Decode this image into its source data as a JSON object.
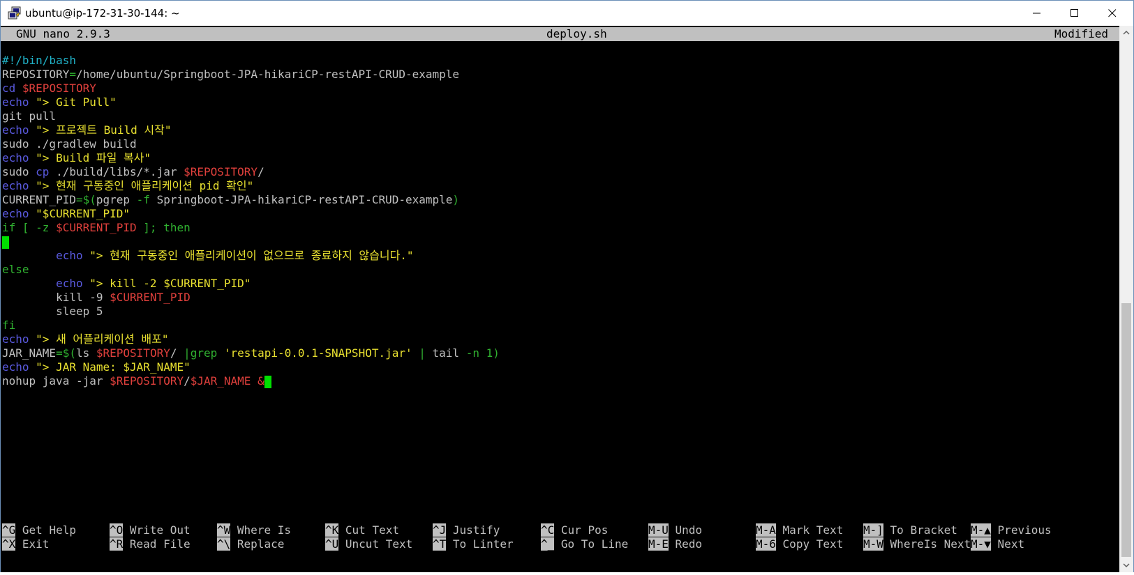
{
  "window": {
    "title": "ubuntu@ip-172-31-30-144: ~",
    "minimize_glyph": "minimize-icon",
    "maximize_glyph": "maximize-icon",
    "close_glyph": "close-icon"
  },
  "header": {
    "version": "GNU nano 2.9.3",
    "filename": "deploy.sh",
    "status": "Modified"
  },
  "lines": [
    [
      {
        "t": "#!/bin/bash",
        "c": "comment"
      }
    ],
    [
      {
        "t": "REPOSITORY",
        "c": "plain"
      },
      {
        "t": "=",
        "c": "green"
      },
      {
        "t": "/home/ubuntu/Springboot-JPA-hikariCP-restAPI-CRUD-example",
        "c": "plain"
      }
    ],
    [
      {
        "t": "cd ",
        "c": "kw"
      },
      {
        "t": "$REPOSITORY",
        "c": "var"
      }
    ],
    [
      {
        "t": "echo ",
        "c": "kw"
      },
      {
        "t": "\"> Git Pull\"",
        "c": "str"
      }
    ],
    [
      {
        "t": "git pull",
        "c": "plain"
      }
    ],
    [
      {
        "t": "echo ",
        "c": "kw"
      },
      {
        "t": "\"> 프로젝트 Build 시작\"",
        "c": "str"
      }
    ],
    [
      {
        "t": "sudo ./gradlew build",
        "c": "plain"
      }
    ],
    [
      {
        "t": "echo ",
        "c": "kw"
      },
      {
        "t": "\"> Build 파일 복사\"",
        "c": "str"
      }
    ],
    [
      {
        "t": "sudo ",
        "c": "plain"
      },
      {
        "t": "cp",
        "c": "kw"
      },
      {
        "t": " ./build/libs/*.jar ",
        "c": "plain"
      },
      {
        "t": "$REPOSITORY",
        "c": "var"
      },
      {
        "t": "/",
        "c": "plain"
      }
    ],
    [
      {
        "t": "echo ",
        "c": "kw"
      },
      {
        "t": "\"> 현재 구동중인 애플리케이션 pid 확인\"",
        "c": "str"
      }
    ],
    [
      {
        "t": "CURRENT_PID",
        "c": "plain"
      },
      {
        "t": "=$(",
        "c": "green"
      },
      {
        "t": "pgrep ",
        "c": "plain"
      },
      {
        "t": "-f",
        "c": "green"
      },
      {
        "t": " Springboot-JPA-hikariCP-restAPI-CRUD-example",
        "c": "plain"
      },
      {
        "t": ")",
        "c": "green"
      }
    ],
    [
      {
        "t": "echo ",
        "c": "kw"
      },
      {
        "t": "\"$CURRENT_PID\"",
        "c": "str"
      }
    ],
    [
      {
        "t": "if [ -z ",
        "c": "green"
      },
      {
        "t": "$CURRENT_PID",
        "c": "var"
      },
      {
        "t": " ]; then",
        "c": "green"
      }
    ],
    [
      {
        "t": "",
        "c": "cursor"
      }
    ],
    [
      {
        "t": "        ",
        "c": "plain"
      },
      {
        "t": "echo ",
        "c": "kw"
      },
      {
        "t": "\"> 현재 구동중인 애플리케이션이 없으므로 종료하지 않습니다.\"",
        "c": "str"
      }
    ],
    [
      {
        "t": "else",
        "c": "green"
      }
    ],
    [
      {
        "t": "        ",
        "c": "plain"
      },
      {
        "t": "echo ",
        "c": "kw"
      },
      {
        "t": "\"> kill -2 $CURRENT_PID\"",
        "c": "str"
      }
    ],
    [
      {
        "t": "        kill -9 ",
        "c": "plain"
      },
      {
        "t": "$CURRENT_PID",
        "c": "var"
      }
    ],
    [
      {
        "t": "        sleep 5",
        "c": "plain"
      }
    ],
    [
      {
        "t": "fi",
        "c": "green"
      }
    ],
    [
      {
        "t": "echo ",
        "c": "kw"
      },
      {
        "t": "\"> 새 어플리케이션 배포\"",
        "c": "str"
      }
    ],
    [
      {
        "t": "JAR_NAME",
        "c": "plain"
      },
      {
        "t": "=$(",
        "c": "green"
      },
      {
        "t": "ls ",
        "c": "plain"
      },
      {
        "t": "$REPOSITORY",
        "c": "var"
      },
      {
        "t": "/ ",
        "c": "plain"
      },
      {
        "t": "|grep ",
        "c": "green"
      },
      {
        "t": "'restapi-0.0.1-SNAPSHOT.jar'",
        "c": "str"
      },
      {
        "t": " | ",
        "c": "green"
      },
      {
        "t": "tail ",
        "c": "plain"
      },
      {
        "t": "-n 1)",
        "c": "green"
      }
    ],
    [
      {
        "t": "echo ",
        "c": "kw"
      },
      {
        "t": "\"> JAR Name: $JAR_NAME\"",
        "c": "str"
      }
    ],
    [
      {
        "t": "nohup java -jar ",
        "c": "plain"
      },
      {
        "t": "$REPOSITORY",
        "c": "var"
      },
      {
        "t": "/",
        "c": "plain"
      },
      {
        "t": "$JAR_NAME",
        "c": "var"
      },
      {
        "t": " &",
        "c": "var"
      },
      {
        "t": "",
        "c": "cursor"
      }
    ]
  ],
  "shortcuts": {
    "row1": [
      {
        "key": "^G",
        "label": "Get Help"
      },
      {
        "key": "^O",
        "label": "Write Out"
      },
      {
        "key": "^W",
        "label": "Where Is"
      },
      {
        "key": "^K",
        "label": "Cut Text"
      },
      {
        "key": "^J",
        "label": "Justify"
      },
      {
        "key": "^C",
        "label": "Cur Pos"
      },
      {
        "key": "M-U",
        "label": "Undo"
      },
      {
        "key": "M-A",
        "label": "Mark Text"
      },
      {
        "key": "M-]",
        "label": "To Bracket"
      },
      {
        "key": "M-▲",
        "label": "Previous"
      }
    ],
    "row2": [
      {
        "key": "^X",
        "label": "Exit"
      },
      {
        "key": "^R",
        "label": "Read File"
      },
      {
        "key": "^\\",
        "label": "Replace"
      },
      {
        "key": "^U",
        "label": "Uncut Text"
      },
      {
        "key": "^T",
        "label": "To Linter"
      },
      {
        "key": "^_",
        "label": "Go To Line"
      },
      {
        "key": "M-E",
        "label": "Redo"
      },
      {
        "key": "M-6",
        "label": "Copy Text"
      },
      {
        "key": "M-W",
        "label": "WhereIs Next"
      },
      {
        "key": "M-▼",
        "label": "Next"
      }
    ]
  },
  "colors": {
    "comment": "#20b2c8",
    "keyword": "#5a5ae0",
    "string": "#e8e030",
    "variable": "#e0403c",
    "operator": "#30b030",
    "cursor": "#00e000"
  }
}
